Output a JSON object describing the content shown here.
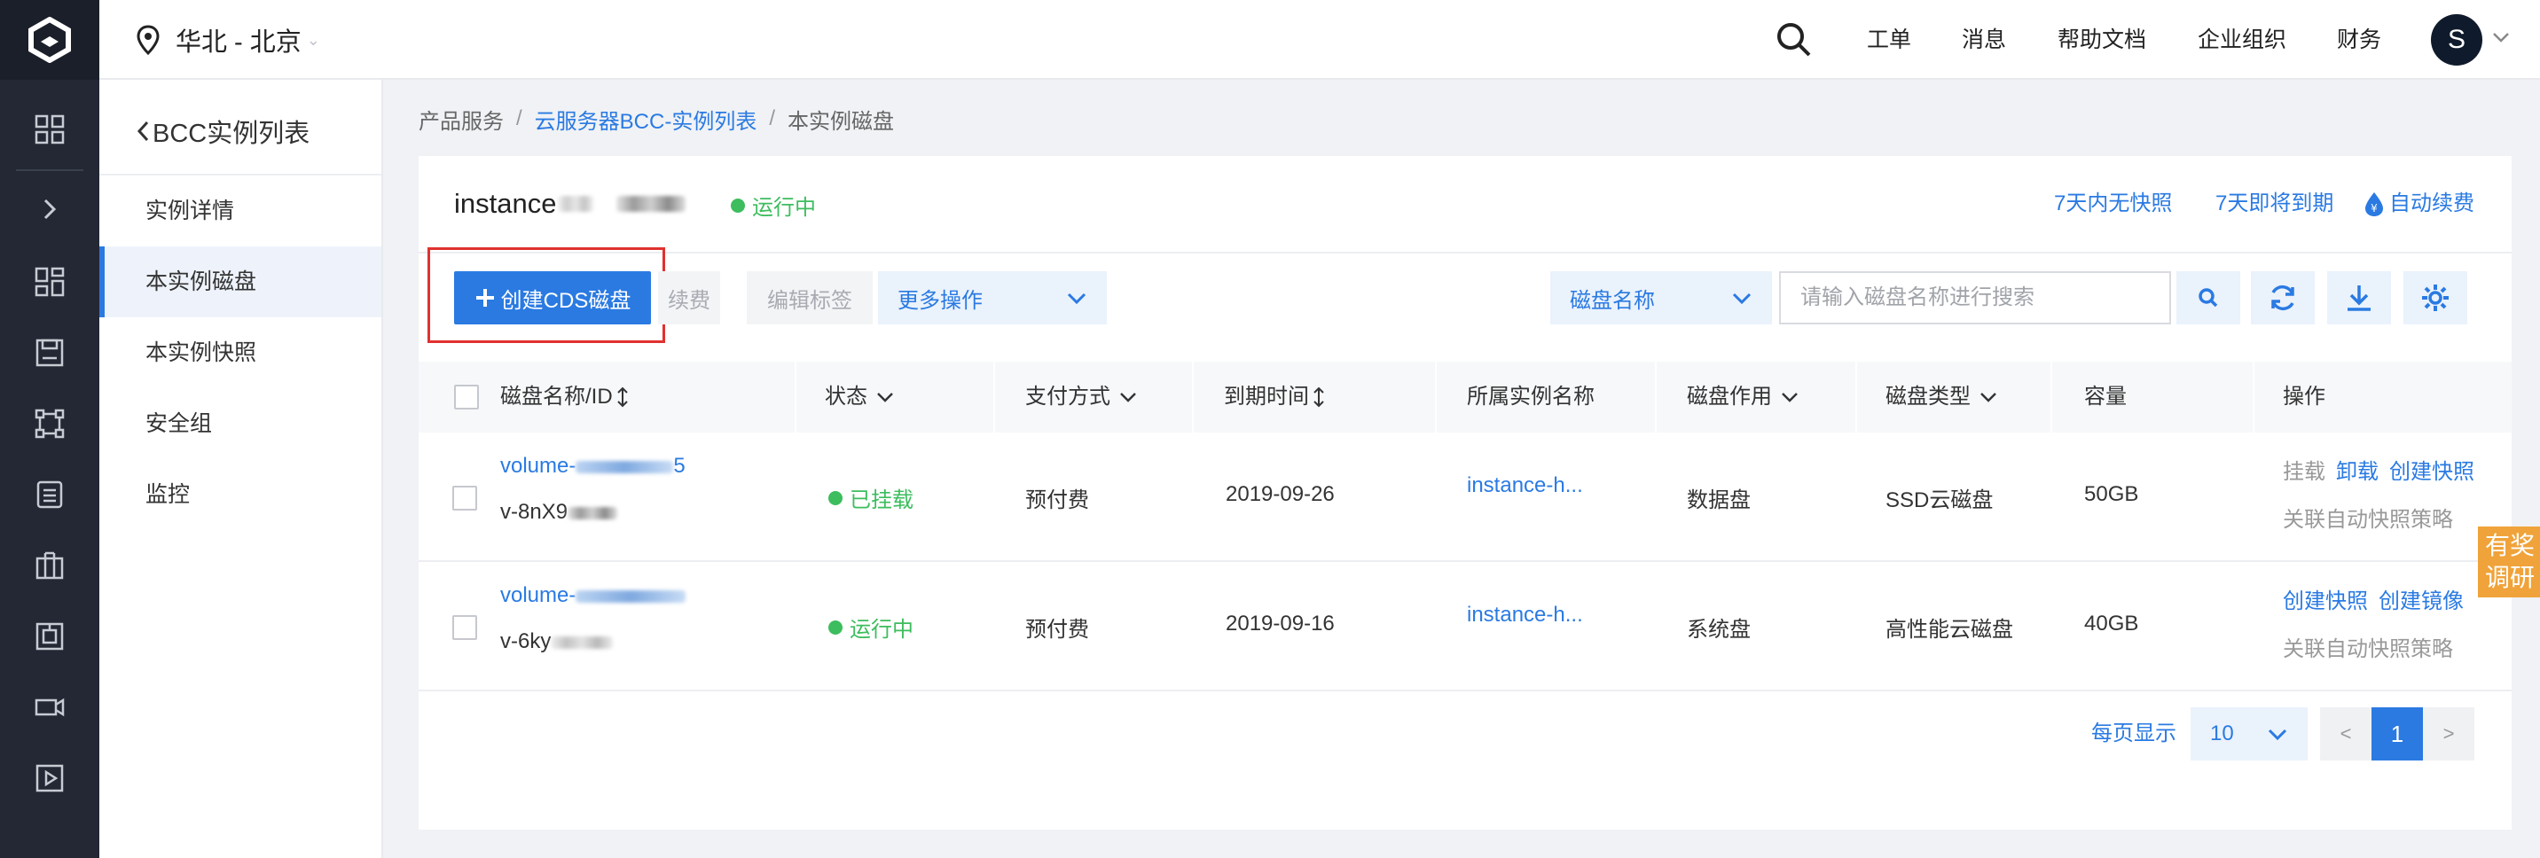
{
  "header": {
    "region": "华北 - 北京",
    "nav": [
      "工单",
      "消息",
      "帮助文档",
      "企业组织",
      "财务"
    ],
    "avatar_initial": "S"
  },
  "sidebar": {
    "back_label": "BCC实例列表",
    "items": [
      {
        "label": "实例详情",
        "active": false
      },
      {
        "label": "本实例磁盘",
        "active": true
      },
      {
        "label": "本实例快照",
        "active": false
      },
      {
        "label": "安全组",
        "active": false
      },
      {
        "label": "监控",
        "active": false
      }
    ]
  },
  "breadcrumb": {
    "items": [
      "产品服务",
      "云服务器BCC-实例列表",
      "本实例磁盘"
    ]
  },
  "instance": {
    "name": "instance",
    "status": "运行中",
    "links": [
      "7天内无快照",
      "7天即将到期",
      "自动续费"
    ]
  },
  "toolbar": {
    "create_label": "创建CDS磁盘",
    "renew_label": "续费",
    "edit_tag_label": "编辑标签",
    "more_label": "更多操作",
    "search_field": "磁盘名称",
    "search_placeholder": "请输入磁盘名称进行搜索"
  },
  "table": {
    "columns": [
      "磁盘名称/ID",
      "状态",
      "支付方式",
      "到期时间",
      "所属实例名称",
      "磁盘作用",
      "磁盘类型",
      "容量",
      "操作"
    ],
    "rows": [
      {
        "name": "volume-",
        "name_tail": "5",
        "id": "v-8nX9",
        "status": "已挂载",
        "payment": "预付费",
        "expire": "2019-09-26",
        "instance": "instance-h...",
        "role": "数据盘",
        "type": "SSD云磁盘",
        "capacity": "50GB",
        "ops": [
          "挂载",
          "卸载",
          "创建快照"
        ],
        "ops2": "关联自动快照策略"
      },
      {
        "name": "volume-",
        "name_tail": "",
        "id": "v-6ky",
        "status": "运行中",
        "payment": "预付费",
        "expire": "2019-09-16",
        "instance": "instance-h...",
        "role": "系统盘",
        "type": "高性能云磁盘",
        "capacity": "40GB",
        "ops": [
          "创建快照",
          "创建镜像"
        ],
        "ops2": "关联自动快照策略"
      }
    ]
  },
  "pagination": {
    "label": "每页显示",
    "page_size": "10",
    "prev": "<",
    "current": "1",
    "next": ">"
  },
  "survey_tab": "有奖调研",
  "colors": {
    "primary": "#2a7ae2",
    "success": "#3dbd5e",
    "rail": "#232834",
    "highlight": "#e0312f",
    "survey": "#f0a33a"
  }
}
